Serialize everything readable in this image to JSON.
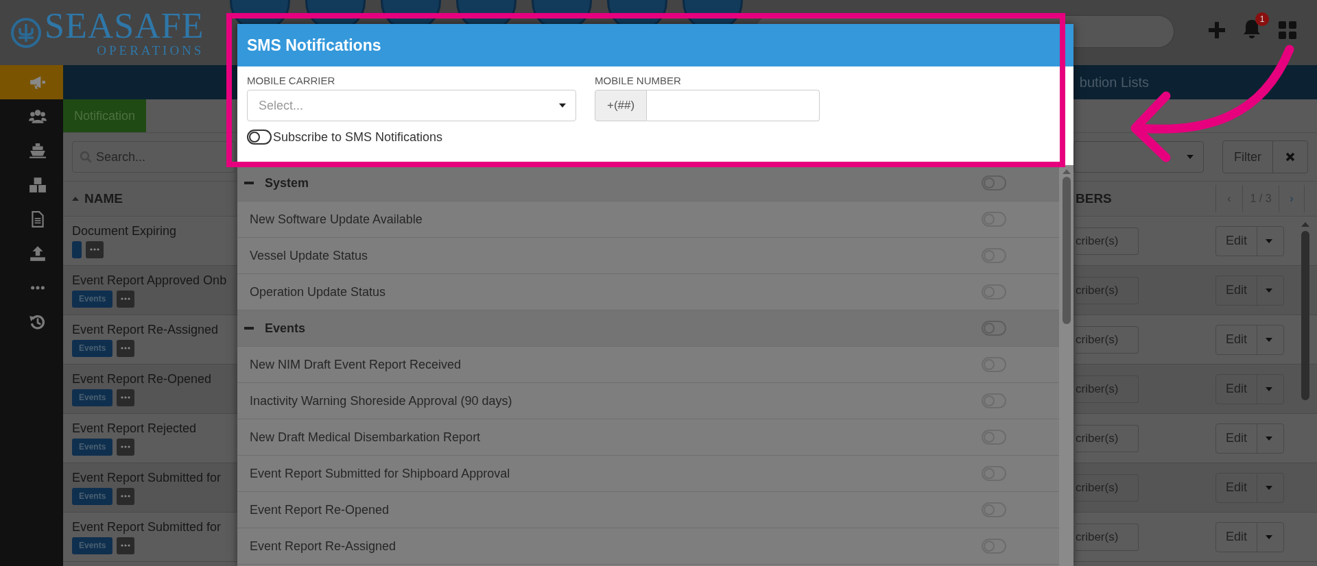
{
  "header": {
    "logo_title": "SEASAFE",
    "logo_subtitle": "OPERATIONS",
    "notification_count": "1"
  },
  "sidebar": {
    "items": [
      {
        "kind": "megaphone",
        "selected": true
      },
      {
        "kind": "users",
        "selected": false
      },
      {
        "kind": "ship",
        "selected": false
      },
      {
        "kind": "cubes",
        "selected": false
      },
      {
        "kind": "file",
        "selected": false
      },
      {
        "kind": "upload",
        "selected": false
      },
      {
        "kind": "more",
        "selected": false
      },
      {
        "kind": "history",
        "selected": false
      }
    ]
  },
  "tab_bar": {
    "visible_label": "bution Lists"
  },
  "notification_tab": "Notification",
  "search": {
    "placeholder": "Search..."
  },
  "filter_button": "Filter",
  "table": {
    "columns": [
      "NAME",
      "BERS"
    ],
    "pagination": {
      "prev": "‹",
      "page": "1 / 3",
      "next": "›"
    },
    "rows": [
      {
        "name": "Document Expiring",
        "subscribers": "criber(s)",
        "action": "Edit"
      },
      {
        "name": "Event Report Approved Onb",
        "tag": "Events",
        "subscribers": "criber(s)",
        "action": "Edit"
      },
      {
        "name": "Event Report Re-Assigned",
        "tag": "Events",
        "subscribers": "criber(s)",
        "action": "Edit"
      },
      {
        "name": "Event Report Re-Opened",
        "tag": "Events",
        "subscribers": "criber(s)",
        "action": "Edit"
      },
      {
        "name": "Event Report Rejected",
        "tag": "Events",
        "subscribers": "criber(s)",
        "action": "Edit"
      },
      {
        "name": "Event Report Submitted for",
        "tag": "Events",
        "subscribers": "criber(s)",
        "action": "Edit"
      },
      {
        "name": "Event Report Submitted for",
        "tag": "Events",
        "subscribers": "criber(s)",
        "action": "Edit"
      }
    ]
  },
  "modal": {
    "title": "SMS Notifications",
    "carrier": {
      "label": "MOBILE CARRIER",
      "placeholder": "Select..."
    },
    "number": {
      "label": "MOBILE NUMBER",
      "prefix": "+(##)"
    },
    "subscribe": {
      "label": "Subscribe to SMS Notifications",
      "on": false
    },
    "groups": [
      {
        "name": "System",
        "expanded": true,
        "on": false,
        "items": [
          {
            "label": "New Software Update Available",
            "on": false
          },
          {
            "label": "Vessel Update Status",
            "on": false
          },
          {
            "label": "Operation Update Status",
            "on": false
          }
        ]
      },
      {
        "name": "Events",
        "expanded": true,
        "on": false,
        "items": [
          {
            "label": "New NIM Draft Event Report Received",
            "on": false
          },
          {
            "label": "Inactivity Warning Shoreside Approval (90 days)",
            "on": false
          },
          {
            "label": "New Draft Medical Disembarkation Report",
            "on": false
          },
          {
            "label": "Event Report Submitted for Shipboard Approval",
            "on": false
          },
          {
            "label": "Event Report Re-Opened",
            "on": false
          },
          {
            "label": "Event Report Re-Assigned",
            "on": false
          }
        ]
      }
    ]
  }
}
